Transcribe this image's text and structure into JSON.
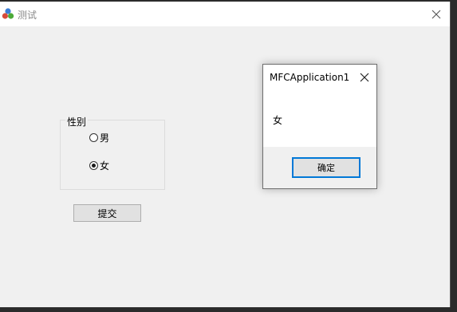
{
  "window": {
    "title": "测试",
    "app_icon": "app-icon",
    "close_icon": "close-icon"
  },
  "form": {
    "group_label": "性别",
    "options": [
      {
        "label": "男",
        "selected": false
      },
      {
        "label": "女",
        "selected": true
      }
    ],
    "submit_label": "提交"
  },
  "message_box": {
    "title": "MFCApplication1",
    "message": "女",
    "ok_label": "确定",
    "close_icon": "close-icon"
  },
  "colors": {
    "accent": "#0078d7",
    "window_bg": "#f0f0f0",
    "titlebar_bg": "#ffffff",
    "title_text": "#8a8a8a"
  }
}
